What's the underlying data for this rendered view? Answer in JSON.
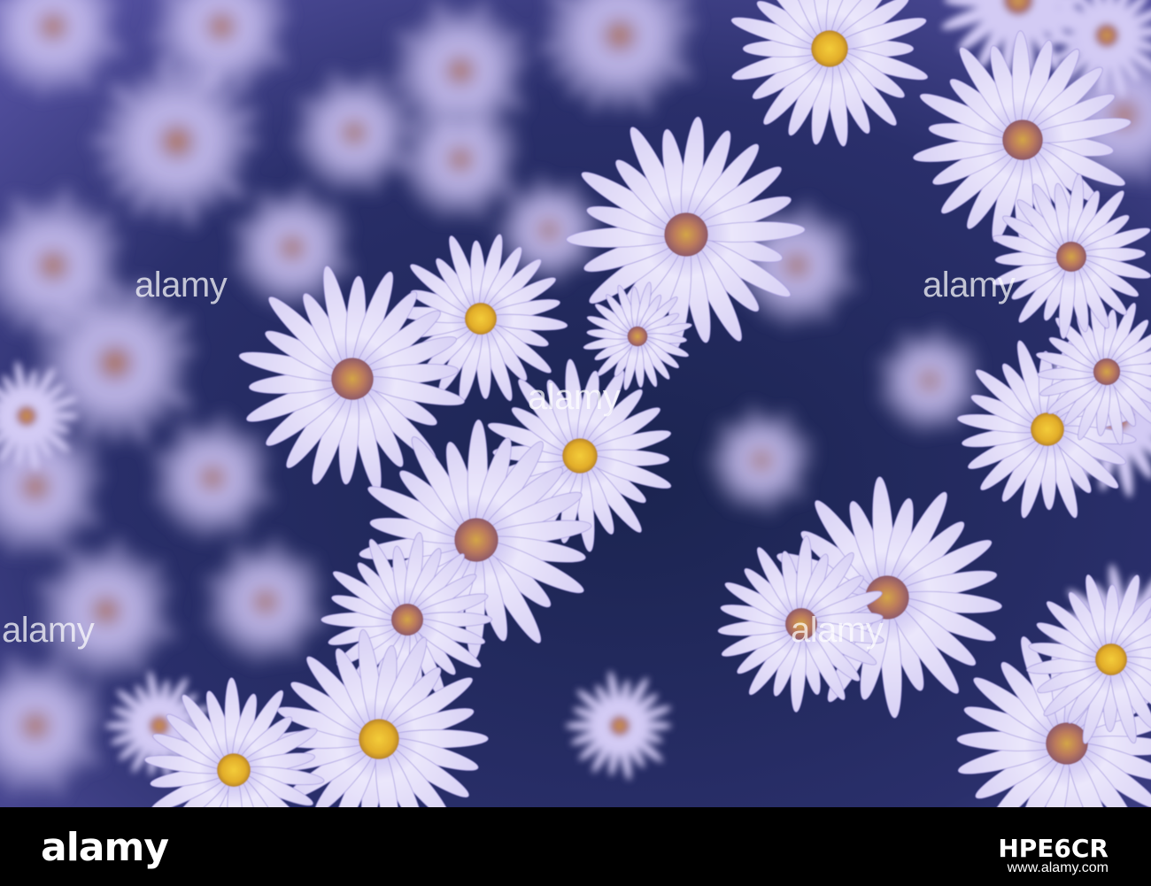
{
  "photo": {
    "subject": "purple aster flowers",
    "colors": {
      "background_deep": "#1d2654",
      "background_mid": "#4a4896",
      "petal": "#dcd6f6",
      "petal_shadow": "#a79ae0",
      "center_yellow": "#e9b931",
      "center_rust": "#b87661"
    },
    "watermark": "alamy"
  },
  "footer": {
    "logo": "alamy",
    "image_id": "HPE6CR",
    "url": "www.alamy.com"
  }
}
